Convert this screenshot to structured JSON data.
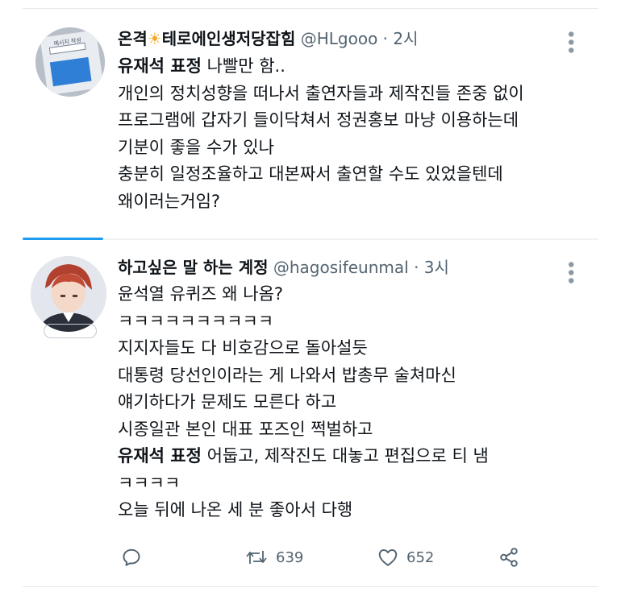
{
  "tweets": [
    {
      "display_name_a": "온격",
      "display_name_emoji": "☀",
      "display_name_b": "테로에인생저당잡힘",
      "handle": "@HLgooo",
      "separator": "·",
      "time": "2시",
      "lines": [
        {
          "bold": "유재석 표정",
          "text": " 나빨만 함.."
        },
        {
          "bold": "",
          "text": "개인의 정치성향을 떠나서 출연자들과 제작진들 존중 없이"
        },
        {
          "bold": "",
          "text": "프로그램에 갑자기 들이닥쳐서 정권홍보 마냥 이용하는데"
        },
        {
          "bold": "",
          "text": "기분이 좋을 수가 있나"
        },
        {
          "bold": "",
          "text": "충분히 일정조율하고 대본짜서 출연할 수도 있었을텐데"
        },
        {
          "bold": "",
          "text": "왜이러는거임?"
        }
      ],
      "avatar_text": "메시지 작성"
    },
    {
      "display_name": "하고싶은 말 하는 계정",
      "handle": "@hagosifeunmal",
      "separator": "·",
      "time": "3시",
      "lines": [
        {
          "bold": "",
          "text": "윤석열 유퀴즈 왜 나옴?"
        },
        {
          "bold": "",
          "text": "ㅋㅋㅋㅋㅋㅋㅋㅋㅋㅋ"
        },
        {
          "bold": "",
          "text": "지지자들도 다 비호감으로 돌아설듯"
        },
        {
          "bold": "",
          "text": "대통령 당선인이라는 게 나와서 밥총무 술쳐마신"
        },
        {
          "bold": "",
          "text": "얘기하다가 문제도 모른다 하고"
        },
        {
          "bold": "",
          "text": "시종일관 본인 대표 포즈인 쩍벌하고"
        },
        {
          "bold": "유재석 표정",
          "text": " 어둡고, 제작진도 대놓고 편집으로 티 냄"
        },
        {
          "bold": "",
          "text": "ㅋㅋㅋㅋ"
        },
        {
          "bold": "",
          "text": "오늘 뒤에 나온 세 분 좋아서 다행"
        }
      ],
      "actions": {
        "reply_icon": "reply-icon",
        "retweet_icon": "retweet-icon",
        "retweet_count": "639",
        "like_icon": "heart-icon",
        "like_count": "652",
        "share_icon": "share-icon"
      }
    }
  ],
  "colors": {
    "text": "#0f1419",
    "secondary": "#536471",
    "accent": "#1d9bf0",
    "divider": "#e7e9ea"
  }
}
